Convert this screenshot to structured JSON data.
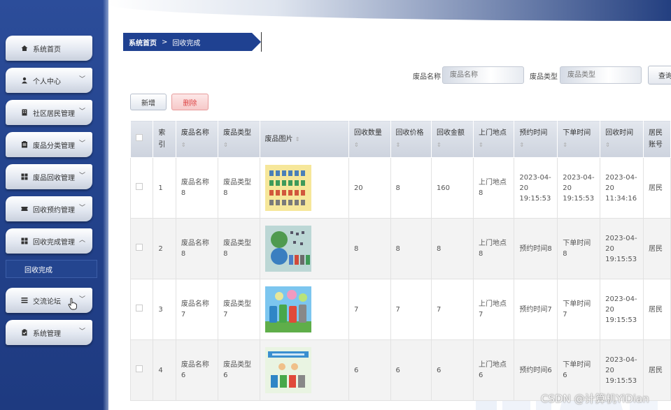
{
  "sidebar": {
    "items": [
      {
        "label": "系统首页",
        "icon": "home-icon",
        "expandable": false
      },
      {
        "label": "个人中心",
        "icon": "user-icon",
        "expandable": true
      },
      {
        "label": "社区居民管理",
        "icon": "building-icon",
        "expandable": true
      },
      {
        "label": "废品分类管理",
        "icon": "folder-icon",
        "expandable": true
      },
      {
        "label": "废品回收管理",
        "icon": "grid-icon",
        "expandable": true
      },
      {
        "label": "回收预约管理",
        "icon": "ticket-icon",
        "expandable": true
      },
      {
        "label": "回收完成管理",
        "icon": "grid-icon",
        "expandable": true,
        "expanded": true
      },
      {
        "label": "交流论坛",
        "icon": "list-icon",
        "expandable": true
      },
      {
        "label": "系统管理",
        "icon": "clipboard-icon",
        "expandable": true
      }
    ],
    "sub_item": "回收完成"
  },
  "breadcrumb": {
    "home": "系统首页",
    "separator": ">",
    "current": "回收完成"
  },
  "search": {
    "name_label": "废品名称",
    "name_placeholder": "废品名称",
    "type_label": "废品类型",
    "type_placeholder": "废品类型",
    "button": "查询"
  },
  "actions": {
    "add": "新增",
    "delete": "删除"
  },
  "table": {
    "headers": [
      "索引",
      "废品名称",
      "废品类型",
      "废品图片",
      "回收数量",
      "回收价格",
      "回收金额",
      "上门地点",
      "预约时间",
      "下单时间",
      "回收时间",
      "居民账号"
    ],
    "rows": [
      {
        "index": "1",
        "name": "废品名称8",
        "type": "废品类型8",
        "qty": "20",
        "price": "8",
        "amount": "160",
        "place": "上门地点8",
        "appoint": "2023-04-20 19:15:53",
        "order": "2023-04-20 19:15:53",
        "recycle": "2023-04-20 11:34:16",
        "resident": "居民"
      },
      {
        "index": "2",
        "name": "废品名称8",
        "type": "废品类型8",
        "qty": "8",
        "price": "8",
        "amount": "8",
        "place": "上门地点8",
        "appoint": "预约时间8",
        "order": "下单时间8",
        "recycle": "2023-04-20 19:15:53",
        "resident": "居民"
      },
      {
        "index": "3",
        "name": "废品名称7",
        "type": "废品类型7",
        "qty": "7",
        "price": "7",
        "amount": "7",
        "place": "上门地点7",
        "appoint": "预约时间7",
        "order": "下单时间7",
        "recycle": "2023-04-20 19:15:53",
        "resident": "居民"
      },
      {
        "index": "4",
        "name": "废品名称6",
        "type": "废品类型6",
        "qty": "6",
        "price": "6",
        "amount": "6",
        "place": "上门地点6",
        "appoint": "预约时间6",
        "order": "下单时间6",
        "recycle": "2023-04-20 19:15:53",
        "resident": "居民"
      }
    ]
  },
  "watermark": "CSDN @计算机YiDian",
  "colors": {
    "sidebar": "#24448e",
    "breadcrumb": "#1f4191",
    "delete": "#d44444"
  }
}
